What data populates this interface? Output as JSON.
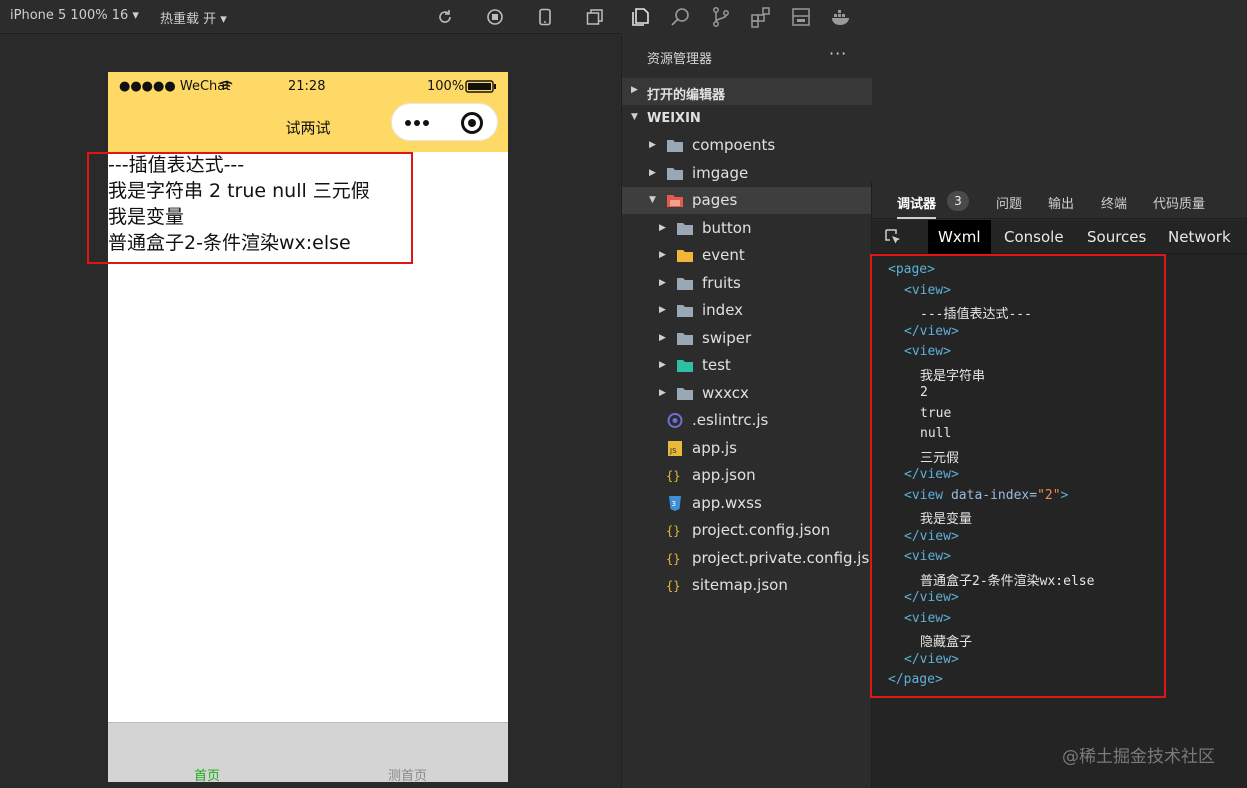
{
  "simulator_toolbar": {
    "device": "iPhone 5 100% 16 ▾",
    "hot_reload": "热重载 开 ▾"
  },
  "phone": {
    "status": {
      "signal": "●●●●● WeChat",
      "time": "21:28",
      "battery": "100%"
    },
    "nav_title": "试两试",
    "lines": [
      {
        "id": "l1",
        "parts": [
          "---插值表达式---"
        ]
      },
      {
        "id": "l2",
        "parts": [
          "我是字符串",
          "2",
          "true",
          "null",
          "三元假"
        ]
      },
      {
        "id": "l3",
        "parts": [
          "我是变量"
        ]
      },
      {
        "id": "l4",
        "parts": [
          "普通盒子2-条件渲染wx:else"
        ]
      }
    ],
    "tabbar": {
      "home": "首页",
      "test": "测首页",
      "home_color": "#1aad19",
      "test_color": "#8a8a8a"
    },
    "accent": "#ffd966"
  },
  "explorer": {
    "title": "资源管理器",
    "more": "···",
    "open_editors": "打开的编辑器",
    "project": "WEIXIN",
    "tree": [
      {
        "name": "compoents",
        "type": "folder",
        "depth": 1,
        "icon": "folder-icon"
      },
      {
        "name": "imgage",
        "type": "folder",
        "depth": 1,
        "icon": "folder-icon"
      },
      {
        "name": "pages",
        "type": "folder-open",
        "depth": 1,
        "icon": "pages-folder-icon",
        "selected": true
      },
      {
        "name": "button",
        "type": "folder",
        "depth": 2,
        "icon": "folder-icon"
      },
      {
        "name": "event",
        "type": "folder",
        "depth": 2,
        "icon": "event-folder-icon"
      },
      {
        "name": "fruits",
        "type": "folder",
        "depth": 2,
        "icon": "folder-icon"
      },
      {
        "name": "index",
        "type": "folder",
        "depth": 2,
        "icon": "folder-icon"
      },
      {
        "name": "swiper",
        "type": "folder",
        "depth": 2,
        "icon": "folder-icon"
      },
      {
        "name": "test",
        "type": "folder",
        "depth": 2,
        "icon": "test-folder-icon"
      },
      {
        "name": "wxxcx",
        "type": "folder",
        "depth": 2,
        "icon": "folder-icon"
      },
      {
        "name": ".eslintrc.js",
        "type": "file",
        "depth": 1,
        "icon": "eslint-icon"
      },
      {
        "name": "app.js",
        "type": "file",
        "depth": 1,
        "icon": "js-file-icon"
      },
      {
        "name": "app.json",
        "type": "file",
        "depth": 1,
        "icon": "json-file-icon"
      },
      {
        "name": "app.wxss",
        "type": "file",
        "depth": 1,
        "icon": "css-file-icon"
      },
      {
        "name": "project.config.json",
        "type": "file",
        "depth": 1,
        "icon": "json-file-icon"
      },
      {
        "name": "project.private.config.js...",
        "type": "file",
        "depth": 1,
        "icon": "json-file-icon"
      },
      {
        "name": "sitemap.json",
        "type": "file",
        "depth": 1,
        "icon": "json-file-icon"
      }
    ]
  },
  "debugger": {
    "tabs": [
      "调试器",
      "问题",
      "输出",
      "终端",
      "代码质量"
    ],
    "badge": "3",
    "devtools_tabs": [
      "Wxml",
      "Console",
      "Sources",
      "Network"
    ],
    "wxml": [
      {
        "indent": 0,
        "kind": "open",
        "tag": "page"
      },
      {
        "indent": 1,
        "kind": "open",
        "tag": "view"
      },
      {
        "indent": 2,
        "kind": "text",
        "text": "---插值表达式---"
      },
      {
        "indent": 1,
        "kind": "close",
        "tag": "view"
      },
      {
        "indent": 1,
        "kind": "open",
        "tag": "view"
      },
      {
        "indent": 2,
        "kind": "text",
        "text": "我是字符串"
      },
      {
        "indent": 2,
        "kind": "text",
        "text": "2"
      },
      {
        "indent": 2,
        "kind": "text",
        "text": "true"
      },
      {
        "indent": 2,
        "kind": "text",
        "text": "null"
      },
      {
        "indent": 2,
        "kind": "text",
        "text": "三元假"
      },
      {
        "indent": 1,
        "kind": "close",
        "tag": "view"
      },
      {
        "indent": 1,
        "kind": "open",
        "tag": "view",
        "attr": "data-index",
        "value": "2"
      },
      {
        "indent": 2,
        "kind": "text",
        "text": "我是变量"
      },
      {
        "indent": 1,
        "kind": "close",
        "tag": "view"
      },
      {
        "indent": 1,
        "kind": "open",
        "tag": "view"
      },
      {
        "indent": 2,
        "kind": "text",
        "text": "普通盒子2-条件渲染wx:else"
      },
      {
        "indent": 1,
        "kind": "close",
        "tag": "view"
      },
      {
        "indent": 1,
        "kind": "open",
        "tag": "view"
      },
      {
        "indent": 2,
        "kind": "text",
        "text": "隐藏盒子"
      },
      {
        "indent": 1,
        "kind": "close",
        "tag": "view"
      },
      {
        "indent": 0,
        "kind": "close",
        "tag": "page"
      }
    ]
  },
  "watermark": "@稀土掘金技术社区",
  "highlight_color": "#e01515"
}
